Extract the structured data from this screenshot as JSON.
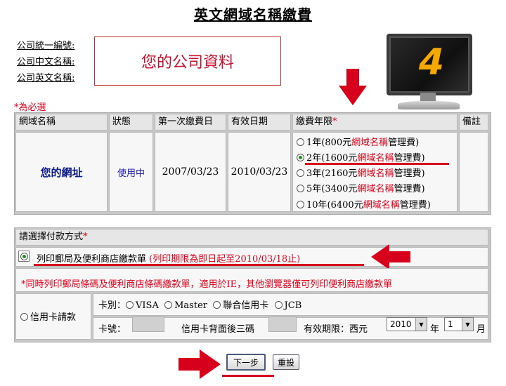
{
  "page": {
    "title": "英文網域名稱繳費"
  },
  "company": {
    "id_label": "公司統一編號",
    "cn_name_label": "公司中文名稱",
    "en_name_label": "公司英文名稱",
    "colon": ":",
    "placeholder_text": "您的公司資料"
  },
  "monitor": {
    "step_number": "4"
  },
  "required_note": "*為必選",
  "domain_table": {
    "headers": [
      "網域名稱",
      "狀態",
      "第一次繳費日",
      "有效日期",
      "繳費年限",
      "備註"
    ],
    "required_mark": "*",
    "row": {
      "domain": "您的網址",
      "status": "使用中",
      "first_payment": "2007/03/23",
      "expiry": "2010/03/23",
      "remark": ""
    },
    "options": [
      {
        "prefix": "1年(800元",
        "mid": "網域名稱",
        "suffix": "管理費)",
        "selected": false
      },
      {
        "prefix": "2年(1600元",
        "mid": "網域名稱",
        "suffix": "管理費)",
        "selected": true
      },
      {
        "prefix": "3年(2160元",
        "mid": "網域名稱",
        "suffix": "管理費)",
        "selected": false
      },
      {
        "prefix": "5年(3400元",
        "mid": "網域名稱",
        "suffix": "管理費)",
        "selected": false
      },
      {
        "prefix": "10年(6400元",
        "mid": "網域名稱",
        "suffix": "管理費)",
        "selected": false
      }
    ]
  },
  "payment": {
    "header": "請選擇付款方式",
    "required_mark": "*",
    "print_option": "列印郵局及便利商店繳款單",
    "print_deadline": "(列印期限為即日起至2010/03/18止)",
    "notice": "*同時列印郵局條碼及便利商店條碼繳款單，適用於IE，其他瀏覽器僅可列印便利商店繳款單",
    "credit_card_option": "信用卡請款",
    "card_type_label": "卡別：",
    "card_types": [
      "VISA",
      "Master",
      "聯合信用卡",
      "JCB"
    ],
    "card_number_label": "卡號：",
    "cvv_label": "信用卡背面後三碼",
    "expiry_label": "有效期限：西元",
    "expiry_year": "2010",
    "year_unit": "年",
    "expiry_month": "1",
    "month_unit": "月"
  },
  "buttons": {
    "next": "下一步",
    "reset": "重設"
  },
  "colors": {
    "accent_red": "#e0001a",
    "annotation_red": "#d6001c",
    "domain_blue": "#0a1a8a",
    "monitor_digit": "#f5a800"
  }
}
